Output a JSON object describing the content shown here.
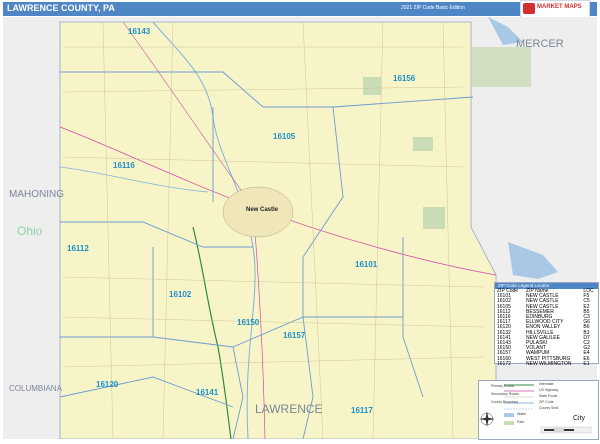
{
  "header": {
    "title": "LAWRENCE COUNTY, PA",
    "edition": "2021 ZIP Code Basic Edition",
    "brand": "MARKET MAPS"
  },
  "map": {
    "neighbors": {
      "mercer": "MERCER",
      "mahoning": "MAHONING",
      "ohio": "Ohio",
      "columbiana": "COLUMBIANA",
      "lawrence": "LAWRENCE"
    },
    "zip_labels": {
      "z16143": "16143",
      "z16156": "16156",
      "z16105": "16105",
      "z16116": "16116",
      "z16112": "16112",
      "z16101": "16101",
      "z16102": "16102",
      "z16150": "16150",
      "z16157": "16157",
      "z16120": "16120",
      "z16141": "16141",
      "z16117": "16117"
    },
    "city": "New Castle",
    "colors": {
      "land": "#f7f5c8",
      "outside": "#eeeeee",
      "water": "#a9c8e6",
      "park": "#c9dcb6",
      "interstate": "#2e8b3e",
      "highway": "#d14aa8",
      "boundary": "#6b9bd1"
    }
  },
  "legend": {
    "header": "ZIP Code Legend Locator",
    "columns": [
      "ZIP Code",
      "ZIP Name",
      "LOC"
    ],
    "rows": [
      [
        "16101",
        "NEW CASTLE",
        "F5"
      ],
      [
        "16102",
        "NEW CASTLE",
        "C5"
      ],
      [
        "16105",
        "NEW CASTLE",
        "E2"
      ],
      [
        "16112",
        "BESSEMER",
        "B5"
      ],
      [
        "16116",
        "EDINBURG",
        "C3"
      ],
      [
        "16117",
        "ELLWOOD CITY",
        "G6"
      ],
      [
        "16120",
        "ENON VALLEY",
        "B6"
      ],
      [
        "16132",
        "HILLSVILLE",
        "B3"
      ],
      [
        "16141",
        "NEW GALILEE",
        "D7"
      ],
      [
        "16143",
        "PULASKI",
        "C2"
      ],
      [
        "16150",
        "VOLANT",
        "G2"
      ],
      [
        "16157",
        "WAMPUM",
        "E4"
      ],
      [
        "16160",
        "WEST PITTSBURG",
        "E6"
      ],
      [
        "16172",
        "NEW WILMINGTON",
        "E1"
      ]
    ]
  },
  "key": {
    "city_label": "City",
    "items": [
      "Interstate",
      "US Highway",
      "State Route",
      "ZIP Code",
      "County Seat",
      "Primary Roads",
      "Secondary Roads",
      "County Boundary",
      "Water",
      "Park"
    ]
  }
}
